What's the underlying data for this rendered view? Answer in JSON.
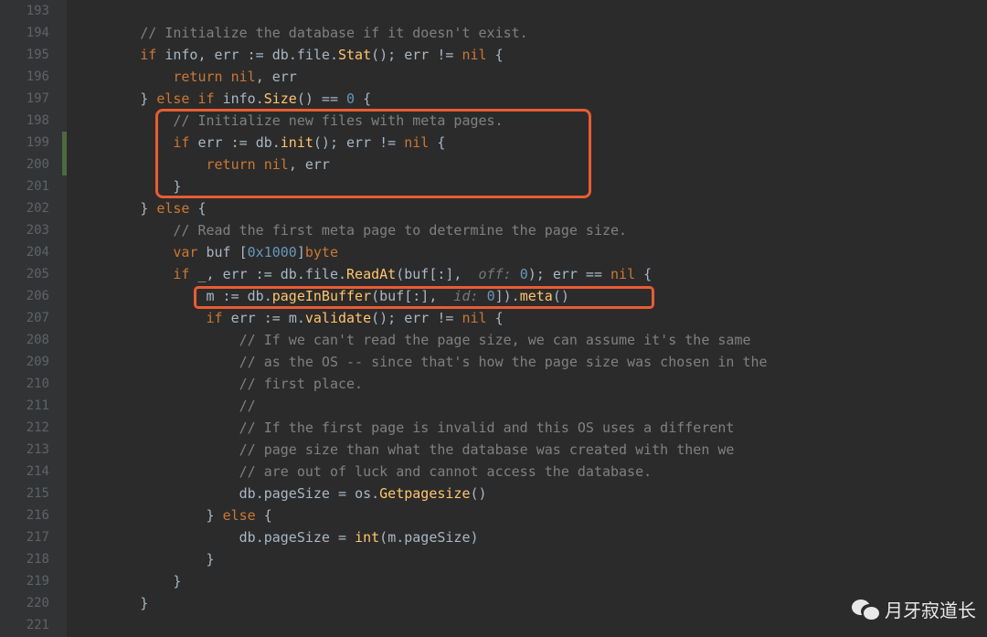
{
  "lineStart": 193,
  "lineEnd": 221,
  "lines": [
    [
      [
        "",
        ""
      ]
    ],
    [
      [
        "cm",
        "        // Initialize the database if it doesn't exist."
      ]
    ],
    [
      [
        "pn",
        "        "
      ],
      [
        "kw",
        "if "
      ],
      [
        "id",
        "info"
      ],
      [
        "pn",
        ", "
      ],
      [
        "id",
        "err"
      ],
      [
        "pn",
        " := "
      ],
      [
        "id",
        "db"
      ],
      [
        "pn",
        "."
      ],
      [
        "id",
        "file"
      ],
      [
        "pn",
        "."
      ],
      [
        "fn",
        "Stat"
      ],
      [
        "pn",
        "(); "
      ],
      [
        "id",
        "err"
      ],
      [
        "pn",
        " != "
      ],
      [
        "kw",
        "nil"
      ],
      [
        "pn",
        " {"
      ]
    ],
    [
      [
        "pn",
        "            "
      ],
      [
        "kw",
        "return "
      ],
      [
        "kw",
        "nil"
      ],
      [
        "pn",
        ", "
      ],
      [
        "id",
        "err"
      ]
    ],
    [
      [
        "pn",
        "        } "
      ],
      [
        "kw",
        "else if "
      ],
      [
        "id",
        "info"
      ],
      [
        "pn",
        "."
      ],
      [
        "fn",
        "Size"
      ],
      [
        "pn",
        "() == "
      ],
      [
        "num",
        "0"
      ],
      [
        "pn",
        " {"
      ]
    ],
    [
      [
        "cm",
        "            // Initialize new files with meta pages."
      ]
    ],
    [
      [
        "pn",
        "            "
      ],
      [
        "kw",
        "if "
      ],
      [
        "id",
        "err"
      ],
      [
        "pn",
        " := "
      ],
      [
        "id",
        "db"
      ],
      [
        "pn",
        "."
      ],
      [
        "fn",
        "init"
      ],
      [
        "pn",
        "(); "
      ],
      [
        "id",
        "err"
      ],
      [
        "pn",
        " != "
      ],
      [
        "kw",
        "nil"
      ],
      [
        "pn",
        " {"
      ]
    ],
    [
      [
        "pn",
        "                "
      ],
      [
        "kw",
        "return "
      ],
      [
        "kw",
        "nil"
      ],
      [
        "pn",
        ", "
      ],
      [
        "id",
        "err"
      ]
    ],
    [
      [
        "pn",
        "            }"
      ]
    ],
    [
      [
        "pn",
        "        } "
      ],
      [
        "kw",
        "else"
      ],
      [
        "pn",
        " {"
      ]
    ],
    [
      [
        "cm",
        "            // Read the first meta page to determine the page size."
      ]
    ],
    [
      [
        "pn",
        "            "
      ],
      [
        "kw",
        "var "
      ],
      [
        "id",
        "buf"
      ],
      [
        "pn",
        " ["
      ],
      [
        "num",
        "0x1000"
      ],
      [
        "pn",
        "]"
      ],
      [
        "kw",
        "byte"
      ]
    ],
    [
      [
        "pn",
        "            "
      ],
      [
        "kw",
        "if "
      ],
      [
        "id",
        "_"
      ],
      [
        "pn",
        ", "
      ],
      [
        "id",
        "err"
      ],
      [
        "pn",
        " := "
      ],
      [
        "id",
        "db"
      ],
      [
        "pn",
        "."
      ],
      [
        "id",
        "file"
      ],
      [
        "pn",
        "."
      ],
      [
        "fn",
        "ReadAt"
      ],
      [
        "pn",
        "("
      ],
      [
        "id",
        "buf"
      ],
      [
        "pn",
        "[:], "
      ],
      [
        "hint",
        " off: "
      ],
      [
        "num",
        "0"
      ],
      [
        "pn",
        "); "
      ],
      [
        "id",
        "err"
      ],
      [
        "pn",
        " == "
      ],
      [
        "kw",
        "nil"
      ],
      [
        "pn",
        " {"
      ]
    ],
    [
      [
        "pn",
        "                "
      ],
      [
        "id",
        "m"
      ],
      [
        "pn",
        " := "
      ],
      [
        "id",
        "db"
      ],
      [
        "pn",
        "."
      ],
      [
        "fn",
        "pageInBuffer"
      ],
      [
        "pn",
        "("
      ],
      [
        "id",
        "buf"
      ],
      [
        "pn",
        "[:], "
      ],
      [
        "hint",
        " id: "
      ],
      [
        "num",
        "0"
      ],
      [
        "pn",
        "])."
      ],
      [
        "fn",
        "meta"
      ],
      [
        "pn",
        "()"
      ]
    ],
    [
      [
        "pn",
        "                "
      ],
      [
        "kw",
        "if "
      ],
      [
        "id",
        "err"
      ],
      [
        "pn",
        " := "
      ],
      [
        "id",
        "m"
      ],
      [
        "pn",
        "."
      ],
      [
        "fn",
        "validate"
      ],
      [
        "pn",
        "(); "
      ],
      [
        "id",
        "err"
      ],
      [
        "pn",
        " != "
      ],
      [
        "kw",
        "nil"
      ],
      [
        "pn",
        " {"
      ]
    ],
    [
      [
        "cm",
        "                    // If we can't read the page size, we can assume it's the same"
      ]
    ],
    [
      [
        "cm",
        "                    // as the OS -- since that's how the page size was chosen in the"
      ]
    ],
    [
      [
        "cm",
        "                    // first place."
      ]
    ],
    [
      [
        "cm",
        "                    //"
      ]
    ],
    [
      [
        "cm",
        "                    // If the first page is invalid and this OS uses a different"
      ]
    ],
    [
      [
        "cm",
        "                    // page size than what the database was created with then we"
      ]
    ],
    [
      [
        "cm",
        "                    // are out of luck and cannot access the database."
      ]
    ],
    [
      [
        "pn",
        "                    "
      ],
      [
        "id",
        "db"
      ],
      [
        "pn",
        "."
      ],
      [
        "id",
        "pageSize"
      ],
      [
        "pn",
        " = "
      ],
      [
        "id",
        "os"
      ],
      [
        "pn",
        "."
      ],
      [
        "fn",
        "Getpagesize"
      ],
      [
        "pn",
        "()"
      ]
    ],
    [
      [
        "pn",
        "                } "
      ],
      [
        "kw",
        "else"
      ],
      [
        "pn",
        " {"
      ]
    ],
    [
      [
        "pn",
        "                    "
      ],
      [
        "id",
        "db"
      ],
      [
        "pn",
        "."
      ],
      [
        "id",
        "pageSize"
      ],
      [
        "pn",
        " = "
      ],
      [
        "fn",
        "int"
      ],
      [
        "pn",
        "("
      ],
      [
        "id",
        "m"
      ],
      [
        "pn",
        "."
      ],
      [
        "id",
        "pageSize"
      ],
      [
        "pn",
        ")"
      ]
    ],
    [
      [
        "pn",
        "                }"
      ]
    ],
    [
      [
        "pn",
        "            }"
      ]
    ],
    [
      [
        "pn",
        "        }"
      ]
    ],
    [
      [
        "",
        ""
      ]
    ]
  ],
  "changeMarks": [
    {
      "startLine": 199,
      "endLine": 200
    }
  ],
  "highlights": [
    {
      "cls": "box1"
    },
    {
      "cls": "box2"
    }
  ],
  "watermark": "月牙寂道长"
}
